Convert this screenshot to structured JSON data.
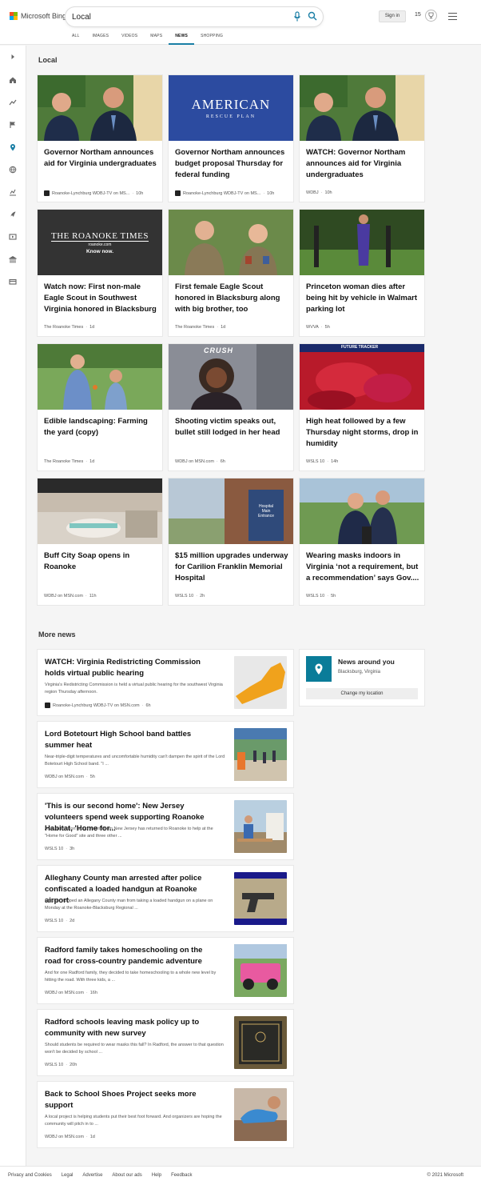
{
  "brand": "Microsoft Bing",
  "search": {
    "query": "Local"
  },
  "header": {
    "signin": "Sign in",
    "rewards_count": "15"
  },
  "tabs": [
    "ALL",
    "IMAGES",
    "VIDEOS",
    "MAPS",
    "NEWS",
    "SHOPPING"
  ],
  "active_tab": "NEWS",
  "local": {
    "title": "Local",
    "cards": [
      {
        "title": "Governor Northam announces aid for Virginia undergraduates",
        "source": "Roanoke-Lynchburg WDBJ-TV on MS...",
        "time": "10h",
        "has_logo": true,
        "image": "two-men-outdoors-photo"
      },
      {
        "title": "Governor Northam announces budget proposal Thursday for federal funding",
        "source": "Roanoke-Lynchburg WDBJ-TV on MS...",
        "time": "10h",
        "has_logo": true,
        "image": "american-rescue-plan-graphic",
        "image_text": [
          "AMERICAN",
          "RESCUE PLAN"
        ]
      },
      {
        "title": "WATCH: Governor Northam announces aid for Virginia undergraduates",
        "source": "WDBJ",
        "time": "10h",
        "has_logo": false,
        "image": "two-men-outdoors-photo"
      },
      {
        "title": "Watch now: First non-male Eagle Scout in Southwest Virginia honored in Blacksburg",
        "source": "The Roanoke Times",
        "time": "1d",
        "has_logo": false,
        "image": "roanoke-times-logo",
        "image_text": [
          "THE ROANOKE TIMES",
          "roanoke.com",
          "Know now."
        ]
      },
      {
        "title": "First female Eagle Scout honored in Blacksburg along with big brother, too",
        "source": "The Roanoke Times",
        "time": "1d",
        "has_logo": false,
        "image": "scouts-saluting-photo"
      },
      {
        "title": "Princeton woman dies after being hit by vehicle in Walmart parking lot",
        "source": "WVVA",
        "time": "5h",
        "has_logo": false,
        "image": "woman-in-park-photo"
      },
      {
        "title": "Edible landscaping: Farming the yard (copy)",
        "source": "The Roanoke Times",
        "time": "1d",
        "has_logo": false,
        "image": "couple-in-garden-photo"
      },
      {
        "title": "Shooting victim speaks out, bullet still lodged in her head",
        "source": "WDBJ on MSN.com",
        "time": "6h",
        "has_logo": false,
        "image": "woman-portrait-photo",
        "image_text": [
          "CRUSH"
        ]
      },
      {
        "title": "High heat followed by a few Thursday night storms, drop in humidity",
        "source": "WSLS 10",
        "time": "14h",
        "has_logo": false,
        "image": "weather-heat-map",
        "image_text": [
          "FUTURE TRACKER"
        ]
      },
      {
        "title": "Buff City Soap opens in Roanoke",
        "source": "WDBJ on MSN.com",
        "time": "11h",
        "has_logo": false,
        "image": "soap-store-interior-photo"
      },
      {
        "title": "$15 million upgrades underway for Carilion Franklin Memorial Hospital",
        "source": "WSLS 10",
        "time": "2h",
        "has_logo": false,
        "image": "hospital-sign-photo",
        "image_text": [
          "Hospital",
          "Main",
          "Entrance"
        ]
      },
      {
        "title": "Wearing masks indoors in Virginia ‘not a requirement, but a recommendation’ says Gov....",
        "source": "WSLS 10",
        "time": "5h",
        "has_logo": false,
        "image": "two-men-at-podium-photo"
      }
    ]
  },
  "more_news": {
    "title": "More news",
    "items": [
      {
        "title": "WATCH: Virginia Redistricting Commission holds virtual public hearing",
        "snippet": "Virginia's Redistricting Commission is held a virtual public hearing for the southwest Virginia region Thursday afternoon.",
        "source": "Roanoke-Lynchburg WDBJ-TV on MSN.com",
        "time": "6h",
        "has_logo": true,
        "image": "virginia-map-graphic"
      },
      {
        "title": "Lord Botetourt High School band battles summer heat",
        "snippet": "Near-triple-digit temperatures and uncomfortable humidity can't dampen the spirit of the Lord Botetourt High School band. \"I ...",
        "source": "WDBJ on MSN.com",
        "time": "5h",
        "has_logo": false,
        "image": "marching-band-photo"
      },
      {
        "title": "'This is our second home': New Jersey volunteers spend week supporting Roanoke Habitat, 'Home for...",
        "snippet": "A youth mission group visiting from New Jersey has returned to Roanoke to help at the \"Home for Good\" site and three other ...",
        "source": "WSLS 10",
        "time": "3h",
        "has_logo": false,
        "image": "volunteers-building-photo"
      },
      {
        "title": "Alleghany County man arrested after police confiscated a loaded handgun at Roanoke airport",
        "snippet": "Officers stopped an Allegany County man from taking a loaded handgun on a plane on Monday at the Roanoke-Blacksburg Regional ...",
        "source": "WSLS 10",
        "time": "2d",
        "has_logo": false,
        "image": "handgun-xray-photo"
      },
      {
        "title": "Radford family takes homeschooling on the road for cross-country pandemic adventure",
        "snippet": "And for one Radford family, they decided to take homeschooling to a whole new level by hitting the road. With three kids, a ...",
        "source": "WDBJ on MSN.com",
        "time": "16h",
        "has_logo": false,
        "image": "pink-jeep-photo"
      },
      {
        "title": "Radford schools leaving mask policy up to community with new survey",
        "snippet": "Should students be required to wear masks this fall? In Radford, the answer to that question won't be decided by school ...",
        "source": "WSLS 10",
        "time": "20h",
        "has_logo": false,
        "image": "school-sign-photo"
      },
      {
        "title": "Back to School Shoes Project seeks more support",
        "snippet": "A local project is helping students put their best foot forward. And organizers are hoping the community will pitch in to ...",
        "source": "WDBJ on MSN.com",
        "time": "1d",
        "has_logo": false,
        "image": "shoes-photo"
      }
    ]
  },
  "news_around_you": {
    "title": "News around you",
    "location": "Blacksburg, Virginia",
    "button": "Change my location"
  },
  "footer": {
    "links": [
      "Privacy and Cookies",
      "Legal",
      "Advertise",
      "About our ads",
      "Help",
      "Feedback"
    ],
    "copyright": "© 2021 Microsoft"
  },
  "colors": {
    "accent": "#1a7ea5",
    "nay_icon_bg": "#0a7c99"
  }
}
